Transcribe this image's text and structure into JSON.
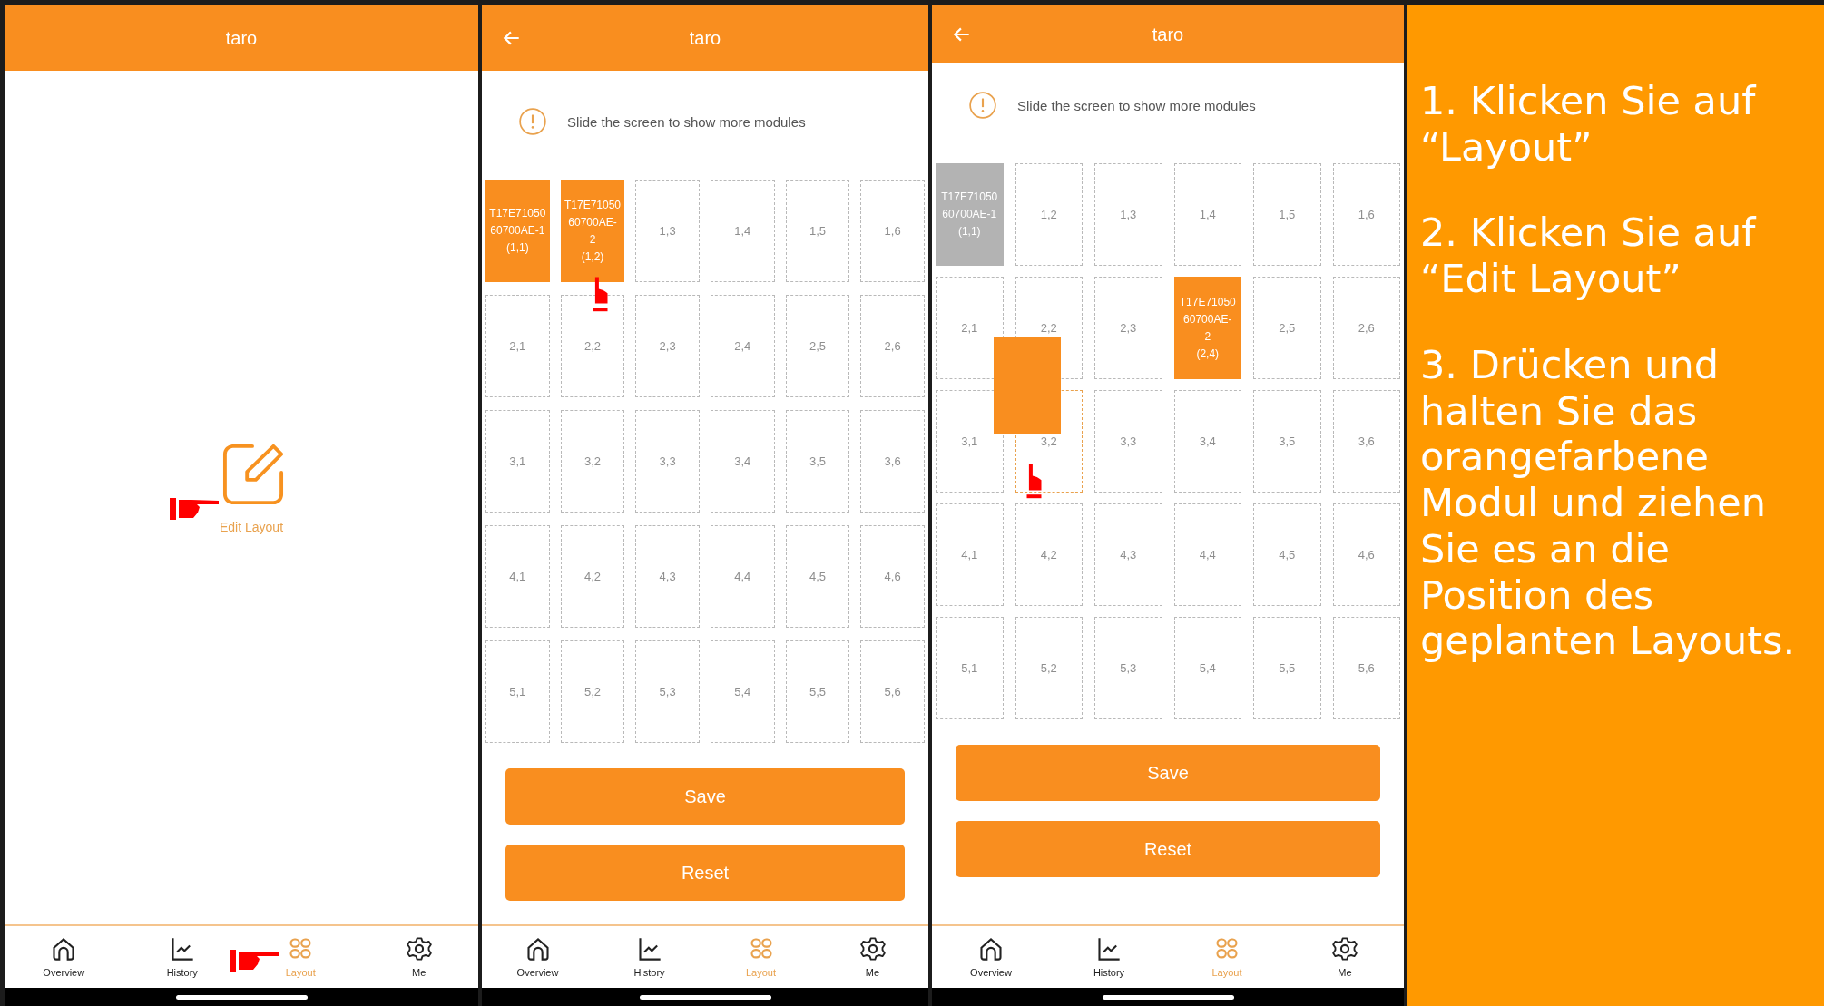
{
  "screens": [
    {
      "kind": "home",
      "title": "taro",
      "action": "Edit Layout",
      "nav": [
        {
          "label": "Overview",
          "selected": false
        },
        {
          "label": "History",
          "selected": false
        },
        {
          "label": "Layout",
          "selected": true
        },
        {
          "label": "Me",
          "selected": false
        }
      ]
    },
    {
      "kind": "grid",
      "title": "taro",
      "tip": "Slide the screen to show more modules",
      "rows": [
        [
          {
            "kind": "module",
            "lines": [
              "T17E71050",
              "60700AE-1",
              "(1,1)"
            ]
          },
          {
            "kind": "module",
            "lines": [
              "T17E71050",
              "60700AE-",
              "2",
              "(1,2)"
            ]
          },
          {
            "kind": "empty",
            "lines": [
              "1,3"
            ]
          },
          {
            "kind": "empty",
            "lines": [
              "1,4"
            ]
          },
          {
            "kind": "empty",
            "lines": [
              "1,5"
            ]
          },
          {
            "kind": "empty",
            "lines": [
              "1,6"
            ]
          }
        ],
        [
          {
            "kind": "empty",
            "lines": [
              "2,1"
            ]
          },
          {
            "kind": "empty",
            "lines": [
              "2,2"
            ]
          },
          {
            "kind": "empty",
            "lines": [
              "2,3"
            ]
          },
          {
            "kind": "empty",
            "lines": [
              "2,4"
            ]
          },
          {
            "kind": "empty",
            "lines": [
              "2,5"
            ]
          },
          {
            "kind": "empty",
            "lines": [
              "2,6"
            ]
          }
        ],
        [
          {
            "kind": "empty",
            "lines": [
              "3,1"
            ]
          },
          {
            "kind": "empty",
            "lines": [
              "3,2"
            ]
          },
          {
            "kind": "empty",
            "lines": [
              "3,3"
            ]
          },
          {
            "kind": "empty",
            "lines": [
              "3,4"
            ]
          },
          {
            "kind": "empty",
            "lines": [
              "3,5"
            ]
          },
          {
            "kind": "empty",
            "lines": [
              "3,6"
            ]
          }
        ],
        [
          {
            "kind": "empty",
            "lines": [
              "4,1"
            ]
          },
          {
            "kind": "empty",
            "lines": [
              "4,2"
            ]
          },
          {
            "kind": "empty",
            "lines": [
              "4,3"
            ]
          },
          {
            "kind": "empty",
            "lines": [
              "4,4"
            ]
          },
          {
            "kind": "empty",
            "lines": [
              "4,5"
            ]
          },
          {
            "kind": "empty",
            "lines": [
              "4,6"
            ]
          }
        ],
        [
          {
            "kind": "empty",
            "lines": [
              "5,1"
            ]
          },
          {
            "kind": "empty",
            "lines": [
              "5,2"
            ]
          },
          {
            "kind": "empty",
            "lines": [
              "5,3"
            ]
          },
          {
            "kind": "empty",
            "lines": [
              "5,4"
            ]
          },
          {
            "kind": "empty",
            "lines": [
              "5,5"
            ]
          },
          {
            "kind": "empty",
            "lines": [
              "5,6"
            ]
          }
        ]
      ],
      "buttons": [
        "Save",
        "Reset"
      ],
      "nav": [
        {
          "label": "Overview",
          "selected": false
        },
        {
          "label": "History",
          "selected": false
        },
        {
          "label": "Layout",
          "selected": true
        },
        {
          "label": "Me",
          "selected": false
        }
      ]
    },
    {
      "kind": "grid",
      "title": "taro",
      "tip": "Slide the screen to show more modules",
      "drag_preview": true,
      "rows": [
        [
          {
            "kind": "ghost",
            "lines": [
              "T17E71050",
              "60700AE-1",
              "(1,1)"
            ]
          },
          {
            "kind": "empty",
            "lines": [
              "1,2"
            ]
          },
          {
            "kind": "empty",
            "lines": [
              "1,3"
            ]
          },
          {
            "kind": "empty",
            "lines": [
              "1,4"
            ]
          },
          {
            "kind": "empty",
            "lines": [
              "1,5"
            ]
          },
          {
            "kind": "empty",
            "lines": [
              "1,6"
            ]
          }
        ],
        [
          {
            "kind": "empty",
            "lines": [
              "2,1"
            ]
          },
          {
            "kind": "empty",
            "lines": [
              "2,2"
            ]
          },
          {
            "kind": "empty",
            "lines": [
              "2,3"
            ]
          },
          {
            "kind": "module",
            "lines": [
              "T17E71050",
              "60700AE-",
              "2",
              "(2,4)"
            ]
          },
          {
            "kind": "empty",
            "lines": [
              "2,5"
            ]
          },
          {
            "kind": "empty",
            "lines": [
              "2,6"
            ]
          }
        ],
        [
          {
            "kind": "empty",
            "lines": [
              "3,1"
            ]
          },
          {
            "kind": "target",
            "lines": [
              "3,2"
            ]
          },
          {
            "kind": "empty",
            "lines": [
              "3,3"
            ]
          },
          {
            "kind": "empty",
            "lines": [
              "3,4"
            ]
          },
          {
            "kind": "empty",
            "lines": [
              "3,5"
            ]
          },
          {
            "kind": "empty",
            "lines": [
              "3,6"
            ]
          }
        ],
        [
          {
            "kind": "empty",
            "lines": [
              "4,1"
            ]
          },
          {
            "kind": "empty",
            "lines": [
              "4,2"
            ]
          },
          {
            "kind": "empty",
            "lines": [
              "4,3"
            ]
          },
          {
            "kind": "empty",
            "lines": [
              "4,4"
            ]
          },
          {
            "kind": "empty",
            "lines": [
              "4,5"
            ]
          },
          {
            "kind": "empty",
            "lines": [
              "4,6"
            ]
          }
        ],
        [
          {
            "kind": "empty",
            "lines": [
              "5,1"
            ]
          },
          {
            "kind": "empty",
            "lines": [
              "5,2"
            ]
          },
          {
            "kind": "empty",
            "lines": [
              "5,3"
            ]
          },
          {
            "kind": "empty",
            "lines": [
              "5,4"
            ]
          },
          {
            "kind": "empty",
            "lines": [
              "5,5"
            ]
          },
          {
            "kind": "empty",
            "lines": [
              "5,6"
            ]
          }
        ]
      ],
      "buttons": [
        "Save",
        "Reset"
      ],
      "nav": [
        {
          "label": "Overview",
          "selected": false
        },
        {
          "label": "History",
          "selected": false
        },
        {
          "label": "Layout",
          "selected": true
        },
        {
          "label": "Me",
          "selected": false
        }
      ]
    }
  ],
  "steps": [
    "1. Klicken Sie auf “Layout”",
    "2. Klicken Sie auf “Edit Layout”",
    "3. Drücken und halten Sie das orangefarbene Modul und ziehen Sie es an die Position des geplanten Layouts."
  ]
}
